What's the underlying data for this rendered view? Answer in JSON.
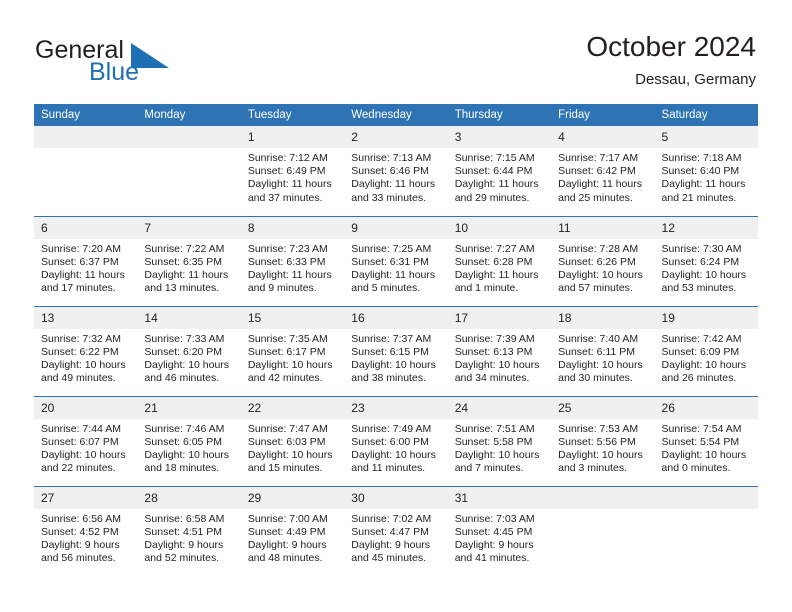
{
  "brand": {
    "name_line1": "General",
    "name_line2": "Blue",
    "mark": "triangle-logo-mark",
    "color_dark": "#231f20",
    "color_blue": "#1f6fb4"
  },
  "header": {
    "title": "October 2024",
    "subtitle": "Dessau, Germany"
  },
  "theme": {
    "header_blue": "#2e74b5",
    "daynum_band": "#f0f0f0",
    "text": "#231f20",
    "page_background": "#ffffff"
  },
  "calendar": {
    "weekdays": [
      "Sunday",
      "Monday",
      "Tuesday",
      "Wednesday",
      "Thursday",
      "Friday",
      "Saturday"
    ],
    "weeks": [
      [
        {
          "day": ""
        },
        {
          "day": ""
        },
        {
          "day": "1",
          "sunrise": "Sunrise: 7:12 AM",
          "sunset": "Sunset: 6:49 PM",
          "daylight_line1": "Daylight: 11 hours",
          "daylight_line2": "and 37 minutes."
        },
        {
          "day": "2",
          "sunrise": "Sunrise: 7:13 AM",
          "sunset": "Sunset: 6:46 PM",
          "daylight_line1": "Daylight: 11 hours",
          "daylight_line2": "and 33 minutes."
        },
        {
          "day": "3",
          "sunrise": "Sunrise: 7:15 AM",
          "sunset": "Sunset: 6:44 PM",
          "daylight_line1": "Daylight: 11 hours",
          "daylight_line2": "and 29 minutes."
        },
        {
          "day": "4",
          "sunrise": "Sunrise: 7:17 AM",
          "sunset": "Sunset: 6:42 PM",
          "daylight_line1": "Daylight: 11 hours",
          "daylight_line2": "and 25 minutes."
        },
        {
          "day": "5",
          "sunrise": "Sunrise: 7:18 AM",
          "sunset": "Sunset: 6:40 PM",
          "daylight_line1": "Daylight: 11 hours",
          "daylight_line2": "and 21 minutes."
        }
      ],
      [
        {
          "day": "6",
          "sunrise": "Sunrise: 7:20 AM",
          "sunset": "Sunset: 6:37 PM",
          "daylight_line1": "Daylight: 11 hours",
          "daylight_line2": "and 17 minutes."
        },
        {
          "day": "7",
          "sunrise": "Sunrise: 7:22 AM",
          "sunset": "Sunset: 6:35 PM",
          "daylight_line1": "Daylight: 11 hours",
          "daylight_line2": "and 13 minutes."
        },
        {
          "day": "8",
          "sunrise": "Sunrise: 7:23 AM",
          "sunset": "Sunset: 6:33 PM",
          "daylight_line1": "Daylight: 11 hours",
          "daylight_line2": "and 9 minutes."
        },
        {
          "day": "9",
          "sunrise": "Sunrise: 7:25 AM",
          "sunset": "Sunset: 6:31 PM",
          "daylight_line1": "Daylight: 11 hours",
          "daylight_line2": "and 5 minutes."
        },
        {
          "day": "10",
          "sunrise": "Sunrise: 7:27 AM",
          "sunset": "Sunset: 6:28 PM",
          "daylight_line1": "Daylight: 11 hours",
          "daylight_line2": "and 1 minute."
        },
        {
          "day": "11",
          "sunrise": "Sunrise: 7:28 AM",
          "sunset": "Sunset: 6:26 PM",
          "daylight_line1": "Daylight: 10 hours",
          "daylight_line2": "and 57 minutes."
        },
        {
          "day": "12",
          "sunrise": "Sunrise: 7:30 AM",
          "sunset": "Sunset: 6:24 PM",
          "daylight_line1": "Daylight: 10 hours",
          "daylight_line2": "and 53 minutes."
        }
      ],
      [
        {
          "day": "13",
          "sunrise": "Sunrise: 7:32 AM",
          "sunset": "Sunset: 6:22 PM",
          "daylight_line1": "Daylight: 10 hours",
          "daylight_line2": "and 49 minutes."
        },
        {
          "day": "14",
          "sunrise": "Sunrise: 7:33 AM",
          "sunset": "Sunset: 6:20 PM",
          "daylight_line1": "Daylight: 10 hours",
          "daylight_line2": "and 46 minutes."
        },
        {
          "day": "15",
          "sunrise": "Sunrise: 7:35 AM",
          "sunset": "Sunset: 6:17 PM",
          "daylight_line1": "Daylight: 10 hours",
          "daylight_line2": "and 42 minutes."
        },
        {
          "day": "16",
          "sunrise": "Sunrise: 7:37 AM",
          "sunset": "Sunset: 6:15 PM",
          "daylight_line1": "Daylight: 10 hours",
          "daylight_line2": "and 38 minutes."
        },
        {
          "day": "17",
          "sunrise": "Sunrise: 7:39 AM",
          "sunset": "Sunset: 6:13 PM",
          "daylight_line1": "Daylight: 10 hours",
          "daylight_line2": "and 34 minutes."
        },
        {
          "day": "18",
          "sunrise": "Sunrise: 7:40 AM",
          "sunset": "Sunset: 6:11 PM",
          "daylight_line1": "Daylight: 10 hours",
          "daylight_line2": "and 30 minutes."
        },
        {
          "day": "19",
          "sunrise": "Sunrise: 7:42 AM",
          "sunset": "Sunset: 6:09 PM",
          "daylight_line1": "Daylight: 10 hours",
          "daylight_line2": "and 26 minutes."
        }
      ],
      [
        {
          "day": "20",
          "sunrise": "Sunrise: 7:44 AM",
          "sunset": "Sunset: 6:07 PM",
          "daylight_line1": "Daylight: 10 hours",
          "daylight_line2": "and 22 minutes."
        },
        {
          "day": "21",
          "sunrise": "Sunrise: 7:46 AM",
          "sunset": "Sunset: 6:05 PM",
          "daylight_line1": "Daylight: 10 hours",
          "daylight_line2": "and 18 minutes."
        },
        {
          "day": "22",
          "sunrise": "Sunrise: 7:47 AM",
          "sunset": "Sunset: 6:03 PM",
          "daylight_line1": "Daylight: 10 hours",
          "daylight_line2": "and 15 minutes."
        },
        {
          "day": "23",
          "sunrise": "Sunrise: 7:49 AM",
          "sunset": "Sunset: 6:00 PM",
          "daylight_line1": "Daylight: 10 hours",
          "daylight_line2": "and 11 minutes."
        },
        {
          "day": "24",
          "sunrise": "Sunrise: 7:51 AM",
          "sunset": "Sunset: 5:58 PM",
          "daylight_line1": "Daylight: 10 hours",
          "daylight_line2": "and 7 minutes."
        },
        {
          "day": "25",
          "sunrise": "Sunrise: 7:53 AM",
          "sunset": "Sunset: 5:56 PM",
          "daylight_line1": "Daylight: 10 hours",
          "daylight_line2": "and 3 minutes."
        },
        {
          "day": "26",
          "sunrise": "Sunrise: 7:54 AM",
          "sunset": "Sunset: 5:54 PM",
          "daylight_line1": "Daylight: 10 hours",
          "daylight_line2": "and 0 minutes."
        }
      ],
      [
        {
          "day": "27",
          "sunrise": "Sunrise: 6:56 AM",
          "sunset": "Sunset: 4:52 PM",
          "daylight_line1": "Daylight: 9 hours",
          "daylight_line2": "and 56 minutes."
        },
        {
          "day": "28",
          "sunrise": "Sunrise: 6:58 AM",
          "sunset": "Sunset: 4:51 PM",
          "daylight_line1": "Daylight: 9 hours",
          "daylight_line2": "and 52 minutes."
        },
        {
          "day": "29",
          "sunrise": "Sunrise: 7:00 AM",
          "sunset": "Sunset: 4:49 PM",
          "daylight_line1": "Daylight: 9 hours",
          "daylight_line2": "and 48 minutes."
        },
        {
          "day": "30",
          "sunrise": "Sunrise: 7:02 AM",
          "sunset": "Sunset: 4:47 PM",
          "daylight_line1": "Daylight: 9 hours",
          "daylight_line2": "and 45 minutes."
        },
        {
          "day": "31",
          "sunrise": "Sunrise: 7:03 AM",
          "sunset": "Sunset: 4:45 PM",
          "daylight_line1": "Daylight: 9 hours",
          "daylight_line2": "and 41 minutes."
        },
        {
          "day": ""
        },
        {
          "day": ""
        }
      ]
    ]
  }
}
